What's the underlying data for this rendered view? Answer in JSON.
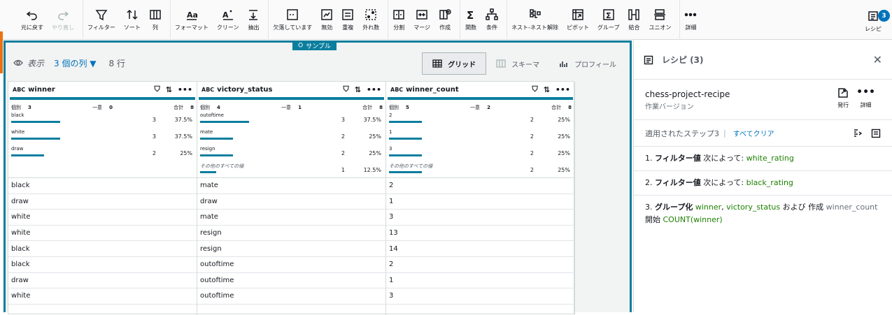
{
  "toolbar": {
    "groups": [
      [
        {
          "icon": "undo-icon",
          "label": "元に戻す",
          "disabled": false
        },
        {
          "icon": "redo-icon",
          "label": "やり直し",
          "disabled": true
        }
      ],
      [
        {
          "icon": "filter-icon",
          "label": "フィルター"
        },
        {
          "icon": "sort-icon",
          "label": "ソート"
        },
        {
          "icon": "column-icon",
          "label": "列"
        }
      ],
      [
        {
          "icon": "format-icon",
          "label": "フォーマット"
        },
        {
          "icon": "clean-icon",
          "label": "クリーン"
        },
        {
          "icon": "extract-icon",
          "label": "抽出"
        }
      ],
      [
        {
          "icon": "missing-icon",
          "label": "欠落しています"
        },
        {
          "icon": "invalid-icon",
          "label": "無効"
        },
        {
          "icon": "duplicate-icon",
          "label": "重複"
        },
        {
          "icon": "outlier-icon",
          "label": "外れ数"
        }
      ],
      [
        {
          "icon": "split-icon",
          "label": "分割"
        },
        {
          "icon": "merge-icon",
          "label": "マージ"
        },
        {
          "icon": "create-icon",
          "label": "作成"
        }
      ],
      [
        {
          "icon": "function-icon",
          "label": "関数"
        },
        {
          "icon": "condition-icon",
          "label": "条件"
        }
      ],
      [
        {
          "icon": "nest-icon",
          "label": "ネスト-ネスト解除"
        },
        {
          "icon": "pivot-icon",
          "label": "ピボット"
        },
        {
          "icon": "group-icon",
          "label": "グループ"
        },
        {
          "icon": "join-icon",
          "label": "結合"
        },
        {
          "icon": "union-icon",
          "label": "ユニオン"
        }
      ],
      [
        {
          "icon": "more-icon",
          "label": "詳細"
        }
      ]
    ],
    "recipe_label": "レシピ",
    "recipe_count": "3"
  },
  "sample_tag": "サンプル",
  "view": {
    "label": "表示",
    "columns": "3 個の列",
    "rows": "8 行",
    "tabs": [
      "グリッド",
      "スキーマ",
      "プロフィール"
    ]
  },
  "columns": [
    {
      "type": "ABC",
      "name": "winner",
      "distinct_label": "個別",
      "distinct": "3",
      "unique_label": "一意",
      "unique": "0",
      "total_label": "合計",
      "total": "8",
      "dist": [
        {
          "label": "black",
          "count": "3",
          "pct": "37.5%",
          "frac": 0.375
        },
        {
          "label": "white",
          "count": "3",
          "pct": "37.5%",
          "frac": 0.375
        },
        {
          "label": "draw",
          "count": "2",
          "pct": "25%",
          "frac": 0.25
        }
      ],
      "cells": [
        "black",
        "draw",
        "white",
        "white",
        "black",
        "black",
        "draw",
        "white"
      ]
    },
    {
      "type": "ABC",
      "name": "victory_status",
      "distinct_label": "個別",
      "distinct": "4",
      "unique_label": "一意",
      "unique": "1",
      "total_label": "合計",
      "total": "8",
      "dist": [
        {
          "label": "outoftime",
          "count": "3",
          "pct": "37.5%",
          "frac": 0.375
        },
        {
          "label": "mate",
          "count": "2",
          "pct": "25%",
          "frac": 0.25
        },
        {
          "label": "resign",
          "count": "2",
          "pct": "25%",
          "frac": 0.25
        },
        {
          "label": "その他のすべての値",
          "count": "1",
          "pct": "12.5%",
          "frac": 0.125,
          "other": true
        }
      ],
      "cells": [
        "mate",
        "draw",
        "mate",
        "resign",
        "resign",
        "outoftime",
        "outoftime",
        "outoftime"
      ]
    },
    {
      "type": "ABC",
      "name": "winner_count",
      "distinct_label": "個別",
      "distinct": "5",
      "unique_label": "一意",
      "unique": "2",
      "total_label": "合計",
      "total": "8",
      "dist": [
        {
          "label": "2",
          "count": "2",
          "pct": "25%",
          "frac": 0.25
        },
        {
          "label": "1",
          "count": "2",
          "pct": "25%",
          "frac": 0.25
        },
        {
          "label": "3",
          "count": "2",
          "pct": "25%",
          "frac": 0.25
        },
        {
          "label": "その他のすべての値",
          "count": "2",
          "pct": "25%",
          "frac": 0.25,
          "other": true
        }
      ],
      "cells": [
        "2",
        "1",
        "3",
        "13",
        "14",
        "2",
        "1",
        "3"
      ]
    }
  ],
  "recipe": {
    "title": "レシピ (3)",
    "name": "chess-project-recipe",
    "version": "作業バージョン",
    "publish_label": "発行",
    "more_label": "詳細",
    "steps_label": "適用されたステップ3",
    "clear_label": "すべてクリア",
    "steps": [
      {
        "num": "1.",
        "action": "フィルター値",
        "mid": "次によって:",
        "field": "white_rating"
      },
      {
        "num": "2.",
        "action": "フィルター値",
        "mid": "次によって:",
        "field": "black_rating"
      }
    ],
    "step3": {
      "num": "3.",
      "action": "グループ化",
      "f1": "winner",
      "comma": ",",
      "f2": "victory_status",
      "and": "および",
      "create": "作成",
      "f3": "winner_count",
      "start": "開始",
      "f4": "COUNT(winner)"
    }
  }
}
